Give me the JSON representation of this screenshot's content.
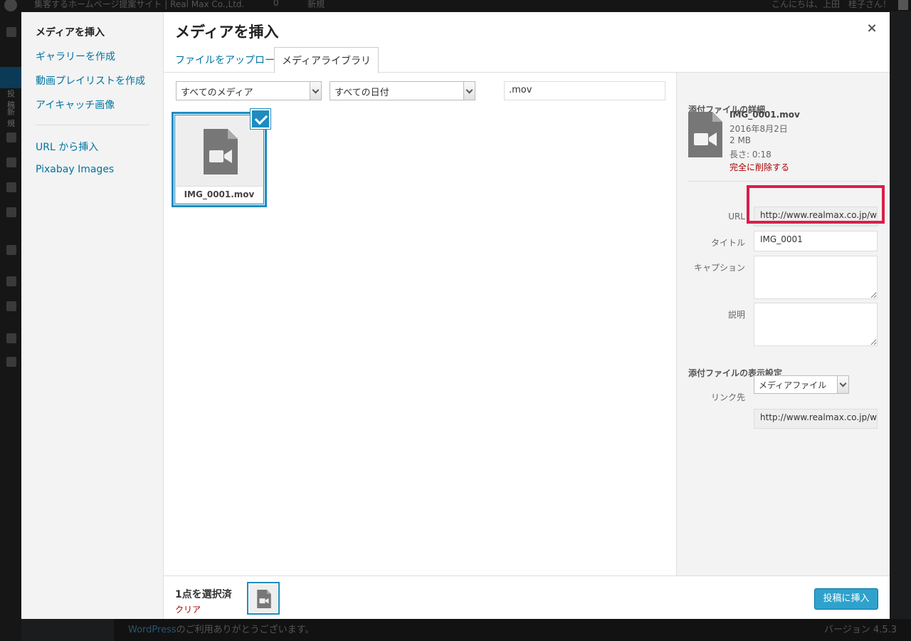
{
  "admin": {
    "site_name": "集客するホームページ提案サイト | Real Max Co.,Ltd.",
    "comments_count": "0",
    "new_label": "新規",
    "howdy": "こんにちは、上田　桂子さん！",
    "menu_labels": [
      "投稿",
      "新規"
    ],
    "footer_link": "WordPress",
    "footer_text": "のご利用ありがとうございます。",
    "version": "バージョン 4.5.3"
  },
  "menu": {
    "items": [
      {
        "label": "メディアを挿入",
        "active": true
      },
      {
        "label": "ギャラリーを作成"
      },
      {
        "label": "動画プレイリストを作成"
      },
      {
        "label": "アイキャッチ画像"
      },
      {
        "label": "URL から挿入"
      },
      {
        "label": "Pixabay Images"
      }
    ]
  },
  "frame": {
    "title": "メディアを挿入",
    "close_symbol": "×",
    "tabs": [
      "ファイルをアップロード",
      "メディアライブラリ"
    ]
  },
  "toolbar": {
    "media_filter": "すべてのメディア",
    "date_filter": "すべての日付",
    "search_value": ".mov"
  },
  "attachment": {
    "filename": "IMG_0001.mov",
    "selected": true
  },
  "details": {
    "heading": "添付ファイルの詳細",
    "filename": "IMG_0001.mov",
    "date": "2016年8月2日",
    "size": "2 MB",
    "length": "長さ: 0:18",
    "delete_label": "完全に削除する",
    "url_label": "URL",
    "url_value": "http://www.realmax.co.jp/w",
    "title_label": "タイトル",
    "title_value": "IMG_0001",
    "caption_label": "キャプション",
    "caption_value": "",
    "description_label": "説明",
    "description_value": ""
  },
  "display": {
    "heading": "添付ファイルの表示設定",
    "link_label": "リンク先",
    "link_value": "メディアファイル",
    "link_url": "http://www.realmax.co.jp/w"
  },
  "bottom": {
    "count": "1点を選択済",
    "clear": "クリア",
    "insert": "投稿に挿入"
  },
  "colors": {
    "accent": "#1e8cbe",
    "highlight": "#d81f4a",
    "danger": "#a00000"
  }
}
